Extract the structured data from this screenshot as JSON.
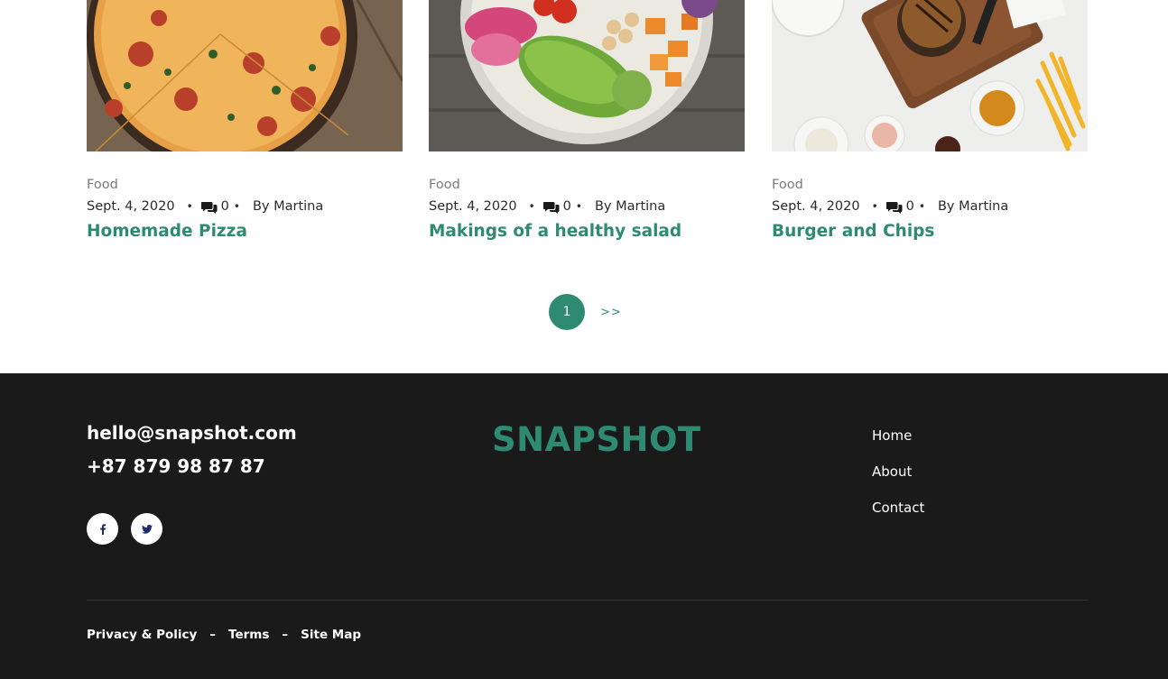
{
  "posts": [
    {
      "category": "Food",
      "date": "Sept. 4, 2020",
      "comments": "0",
      "author": "By Martina",
      "title": "Homemade Pizza"
    },
    {
      "category": "Food",
      "date": "Sept. 4, 2020",
      "comments": "0",
      "author": "By Martina",
      "title": "Makings of a healthy salad"
    },
    {
      "category": "Food",
      "date": "Sept. 4, 2020",
      "comments": "0",
      "author": "By Martina",
      "title": "Burger and Chips"
    }
  ],
  "meta_separator": "•",
  "pagination": {
    "current": "1",
    "next": ">>"
  },
  "footer": {
    "email": "hello@snapshot.com",
    "phone": "+87 879 98 87 87",
    "brand": "SNAPSHOT",
    "social": [
      {
        "icon": "facebook-icon"
      },
      {
        "icon": "twitter-icon"
      }
    ],
    "nav": [
      "Home",
      "About",
      "Contact"
    ],
    "legal": [
      "Privacy & Policy",
      "Terms",
      "Site Map"
    ],
    "legal_separator": "–"
  },
  "colors": {
    "accent": "#2e8b72",
    "footer_bg": "#1a1a1a",
    "social_icon": "#1d2b6b"
  }
}
